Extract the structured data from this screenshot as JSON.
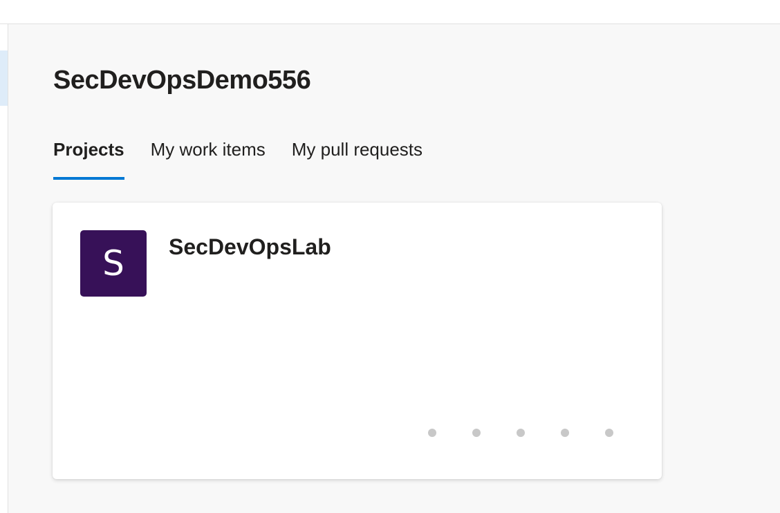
{
  "organization": {
    "name": "SecDevOpsDemo556"
  },
  "tabs": [
    {
      "label": "Projects",
      "active": true
    },
    {
      "label": "My work items",
      "active": false
    },
    {
      "label": "My pull requests",
      "active": false
    }
  ],
  "projects": [
    {
      "name": "SecDevOpsLab",
      "avatar_letter": "S",
      "avatar_color": "#371158",
      "stats_loading_indicators": 5
    }
  ],
  "colors": {
    "accent": "#0078d4",
    "background": "#f8f8f8",
    "card": "#ffffff",
    "placeholder_dot": "#c8c8c8"
  }
}
